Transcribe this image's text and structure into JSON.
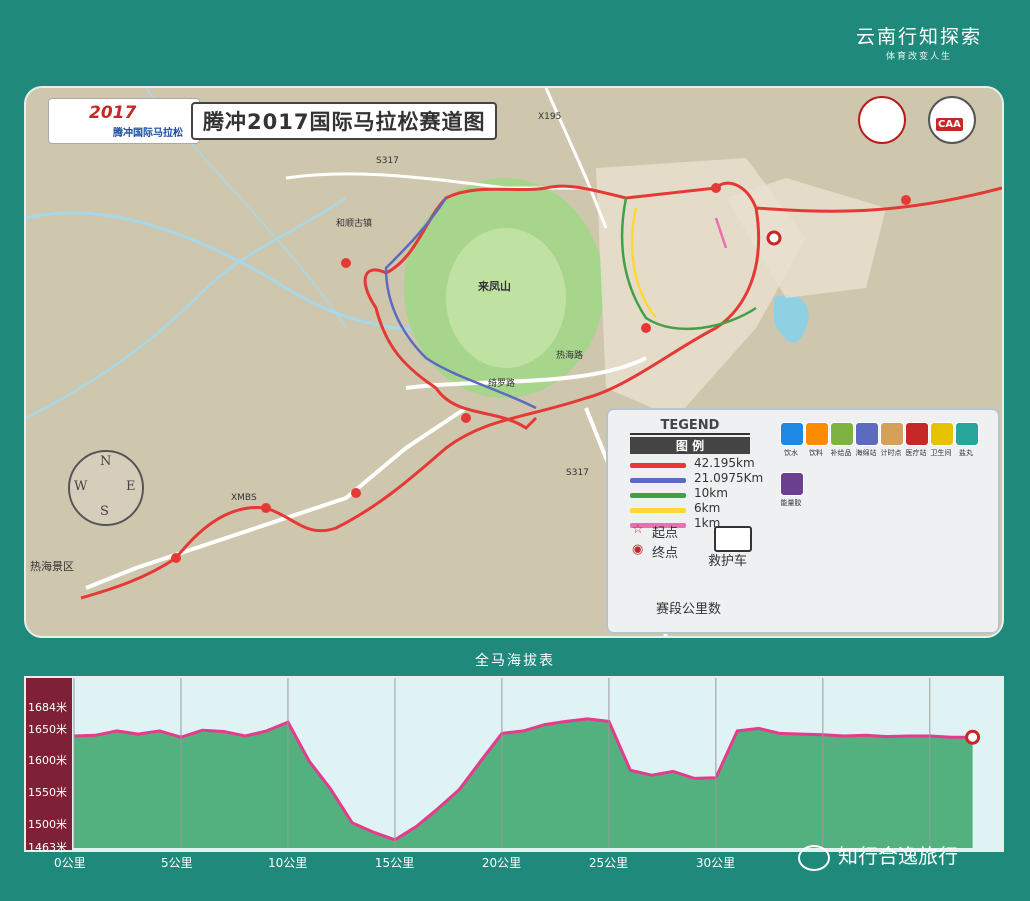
{
  "brand": {
    "line1": "云南行知探索",
    "line2": "体育改变人生"
  },
  "map": {
    "logo_year": "2017",
    "logo_name": "腾冲国际马拉松",
    "title": "腾冲2017国际马拉松赛道图",
    "emblem_right": "CAA",
    "places": [
      {
        "name": "来凤山",
        "id": "laifeng"
      },
      {
        "name": "和顺古镇",
        "id": "heshun"
      },
      {
        "name": "热海景区",
        "id": "rehai"
      },
      {
        "name": "绮罗路",
        "id": "road1"
      },
      {
        "name": "热海路",
        "id": "road2"
      },
      {
        "name": "S317",
        "id": "s317a"
      },
      {
        "name": "S317",
        "id": "s317b"
      },
      {
        "name": "XMBS",
        "id": "xmbs"
      },
      {
        "name": "X195",
        "id": "x195"
      }
    ],
    "compass_letters": [
      "N",
      "S",
      "W",
      "E"
    ]
  },
  "legend": {
    "title_en": "TEGEND",
    "title_cn": "图 例",
    "routes": [
      {
        "label": "42.195km",
        "color": "#e53935"
      },
      {
        "label": "21.0975Km",
        "color": "#5c6bc0"
      },
      {
        "label": "10km",
        "color": "#43a047"
      },
      {
        "label": "6km",
        "color": "#fdd835"
      },
      {
        "label": "1km",
        "color": "#ec6fb1"
      }
    ],
    "start_label": "起点",
    "finish_label": "终点",
    "ambulance_label": "救护车",
    "segments_label": "赛段公里数",
    "services": [
      {
        "label": "饮水",
        "color": "#1e88e5"
      },
      {
        "label": "饮料",
        "color": "#fb8c00"
      },
      {
        "label": "补给品",
        "color": "#7cb342"
      },
      {
        "label": "海绵站",
        "color": "#5c6bc0"
      },
      {
        "label": "计时点",
        "color": "#d4a05a"
      },
      {
        "label": "医疗站",
        "color": "#c62828"
      },
      {
        "label": "卫生间",
        "color": "#e6c200"
      },
      {
        "label": "盐丸",
        "color": "#26a69a"
      },
      {
        "label": "能量胶",
        "color": "#6d3f91"
      }
    ]
  },
  "elevation": {
    "title": "全马海拔表",
    "y_labels": [
      "1684米",
      "1650米",
      "1600米",
      "1550米",
      "1500米",
      "1463米"
    ],
    "x_labels": [
      "0公里",
      "5公里",
      "10公里",
      "15公里",
      "20公里",
      "25公里",
      "30公里"
    ],
    "profile_km": [
      0,
      1,
      2,
      3,
      4,
      5,
      6,
      7,
      8,
      9,
      10,
      11,
      12,
      13,
      14,
      15,
      16,
      17,
      18,
      19,
      20,
      21,
      22,
      23,
      24,
      25,
      26,
      27,
      28,
      29,
      30,
      31,
      32,
      33,
      34,
      35,
      36,
      37,
      38,
      39,
      40,
      41,
      42
    ],
    "profile_m": [
      1640,
      1641,
      1648,
      1643,
      1648,
      1638,
      1649,
      1647,
      1640,
      1648,
      1662,
      1600,
      1556,
      1503,
      1488,
      1476,
      1497,
      1525,
      1555,
      1600,
      1644,
      1648,
      1658,
      1663,
      1667,
      1663,
      1586,
      1578,
      1584,
      1573,
      1574,
      1648,
      1652,
      1644,
      1643,
      1642,
      1640,
      1641,
      1639,
      1640,
      1640,
      1638,
      1638
    ],
    "y_range": [
      1463,
      1700
    ],
    "x_range": [
      0,
      43
    ],
    "line_color": "#e53b8c",
    "fill_color": "#39a56a"
  },
  "watermark": "知行合逸旅行"
}
